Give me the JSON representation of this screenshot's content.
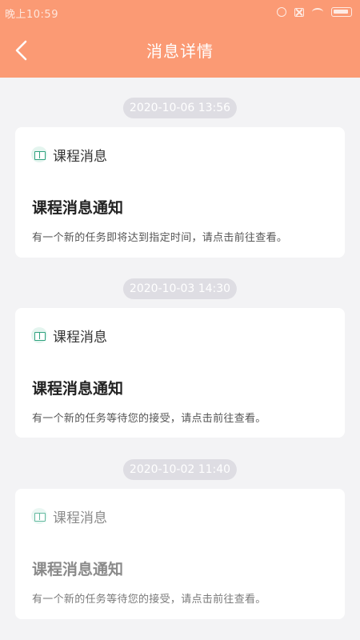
{
  "status_bar": {
    "time": "晚上10:59"
  },
  "header": {
    "title": "消息详情"
  },
  "messages": [
    {
      "timestamp": "2020-10-06 13:56",
      "category": "课程消息",
      "title": "课程消息通知",
      "body": "有一个新的任务即将达到指定时间，请点击前往查看。"
    },
    {
      "timestamp": "2020-10-03 14:30",
      "category": "课程消息",
      "title": "课程消息通知",
      "body": "有一个新的任务等待您的接受，请点击前往查看。"
    },
    {
      "timestamp": "2020-10-02 11:40",
      "category": "课程消息",
      "title": "课程消息通知",
      "body": "有一个新的任务等待您的接受，请点击前往查看。"
    }
  ],
  "colors": {
    "header_bg": "#fb9a74",
    "page_bg": "#f3f3f5",
    "icon_accent": "#2ea27e"
  }
}
